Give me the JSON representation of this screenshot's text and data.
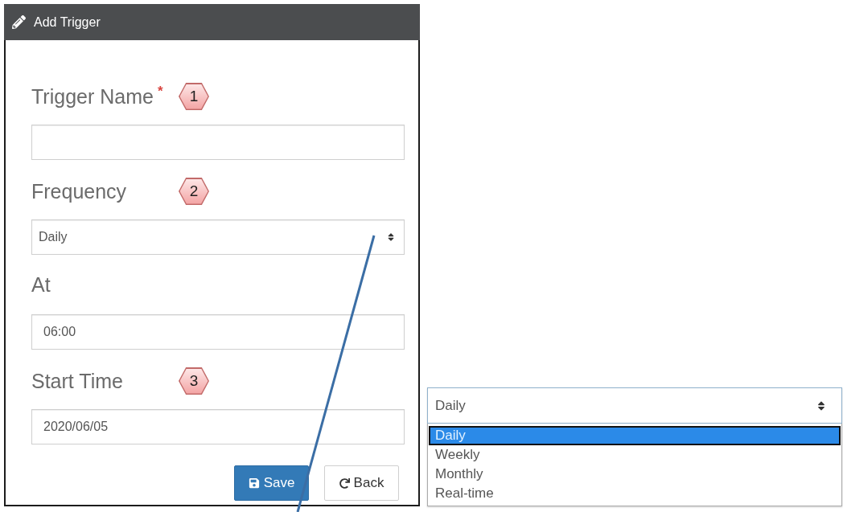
{
  "panel": {
    "title": "Add Trigger"
  },
  "fields": [
    {
      "kind": "text",
      "label": "Trigger Name",
      "required_mark": "*",
      "badge": "1"
    },
    {
      "kind": "select",
      "label": "Frequency",
      "badge": "2",
      "value": "Daily"
    },
    {
      "kind": "text",
      "label": "At",
      "value": "06:00"
    },
    {
      "kind": "text",
      "label": "Start Time",
      "badge": "3",
      "value": "2020/06/05"
    }
  ],
  "buttons": [
    {
      "kind": "primary",
      "label": "Save"
    },
    {
      "kind": "default",
      "label": "Back"
    }
  ],
  "dropdown": {
    "value": "Daily",
    "options": [
      {
        "label": "Daily",
        "selected": true
      },
      {
        "label": "Weekly",
        "selected": false
      },
      {
        "label": "Monthly",
        "selected": false
      },
      {
        "label": "Real-time",
        "selected": false
      }
    ]
  }
}
